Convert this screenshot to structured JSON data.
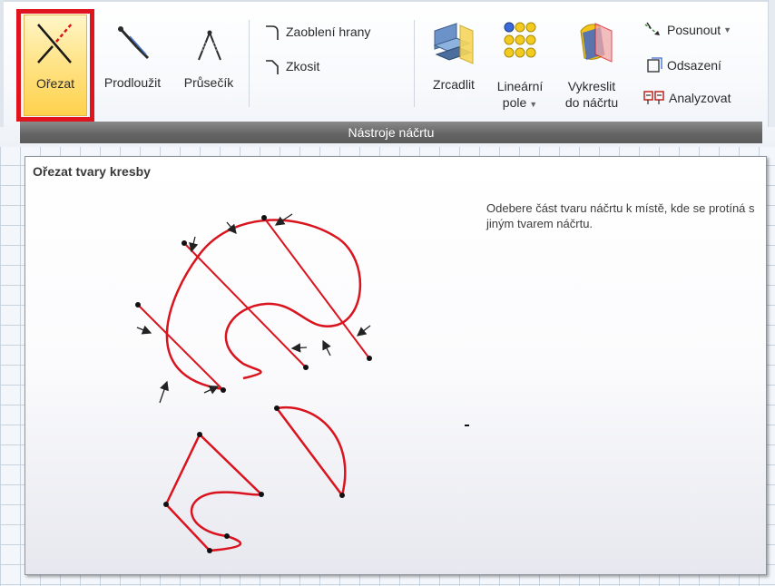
{
  "ribbon": {
    "tools": {
      "trim": "Ořezat",
      "extend": "Prodloužit",
      "intersection": "Průsečík",
      "fillet": "Zaoblení hrany",
      "chamfer": "Zkosit",
      "mirror": "Zrcadlit",
      "linear_pattern_line1": "Lineární",
      "linear_pattern_line2": "pole",
      "project_line1": "Vykreslit",
      "project_line2": "do náčrtu",
      "move": "Posunout",
      "offset": "Odsazení",
      "analyze": "Analyzovat"
    },
    "group_label": "Nástroje náčrtu"
  },
  "tooltip": {
    "title": "Ořezat tvary kresby",
    "description": "Odebere část tvaru náčrtu k místě, kde se protíná s jiným tvarem náčrtu."
  },
  "colors": {
    "curve": "#d9141e",
    "highlight": "#e0141e",
    "group_bar": "#666666"
  }
}
